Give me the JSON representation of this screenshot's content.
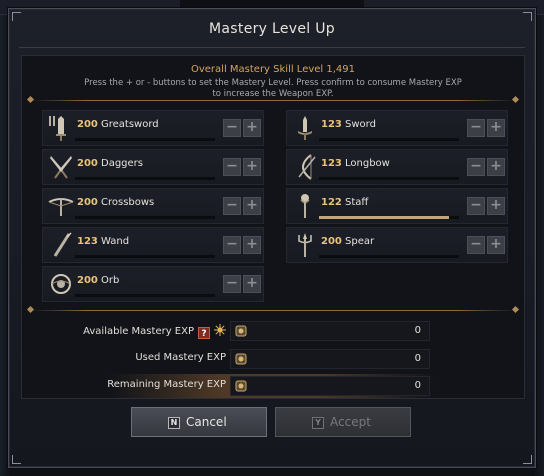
{
  "dialog": {
    "title": "Mastery Level Up",
    "overall": "Overall Mastery Skill Level 1,491",
    "hint": "Press the + or - buttons to set the Mastery Level. Press confirm to consume Mastery EXP to increase the Weapon EXP."
  },
  "weapons": [
    {
      "level": "200",
      "name": "Greatsword",
      "icon": "greatsword-icon",
      "progress": 0
    },
    {
      "level": "123",
      "name": "Sword",
      "icon": "sword-icon",
      "progress": 0
    },
    {
      "level": "200",
      "name": "Daggers",
      "icon": "daggers-icon",
      "progress": 0
    },
    {
      "level": "123",
      "name": "Longbow",
      "icon": "longbow-icon",
      "progress": 0
    },
    {
      "level": "200",
      "name": "Crossbows",
      "icon": "crossbow-icon",
      "progress": 0
    },
    {
      "level": "122",
      "name": "Staff",
      "icon": "staff-icon",
      "progress": 0.93
    },
    {
      "level": "123",
      "name": "Wand",
      "icon": "wand-icon",
      "progress": 0
    },
    {
      "level": "200",
      "name": "Spear",
      "icon": "spear-icon",
      "progress": 0
    },
    {
      "level": "200",
      "name": "Orb",
      "icon": "orb-icon",
      "progress": 0
    }
  ],
  "stepper": {
    "minus": "−",
    "plus": "+"
  },
  "summary": {
    "available_label": "Available Mastery EXP",
    "available_value": "0",
    "help_mark": "?",
    "used_label": "Used Mastery EXP",
    "used_value": "0",
    "remaining_label": "Remaining Mastery EXP",
    "remaining_value": "0"
  },
  "buttons": {
    "cancel_key": "N",
    "cancel_label": "Cancel",
    "accept_key": "Y",
    "accept_label": "Accept"
  },
  "colors": {
    "accent": "#e9c27b",
    "progress": "#c7a476",
    "ornament": "#8d6a3c"
  }
}
